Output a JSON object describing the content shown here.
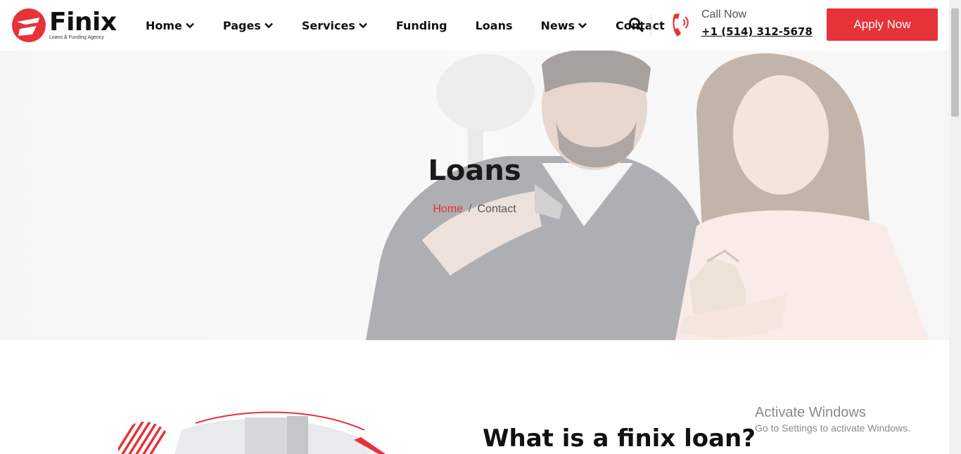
{
  "brand": {
    "name": "Finix",
    "tagline": "Loans & Funding Agency",
    "accent_color": "#e63238"
  },
  "nav": {
    "items": [
      {
        "label": "Home",
        "has_dropdown": true
      },
      {
        "label": "Pages",
        "has_dropdown": true
      },
      {
        "label": "Services",
        "has_dropdown": true
      },
      {
        "label": "Funding",
        "has_dropdown": false
      },
      {
        "label": "Loans",
        "has_dropdown": false
      },
      {
        "label": "News",
        "has_dropdown": true
      },
      {
        "label": "Contact",
        "has_dropdown": false
      }
    ],
    "search_icon": "search-icon"
  },
  "call": {
    "label": "Call Now",
    "number": "+1 (514) 312-5678",
    "icon": "phone-icon"
  },
  "cta": {
    "apply_label": "Apply Now"
  },
  "hero": {
    "title": "Loans",
    "breadcrumb": {
      "home": "Home",
      "separator": "/",
      "current": "Contact"
    }
  },
  "content": {
    "heading": "What is a finix loan?"
  },
  "watermark": {
    "title": "Activate Windows",
    "subtitle": "Go to Settings to activate Windows."
  }
}
